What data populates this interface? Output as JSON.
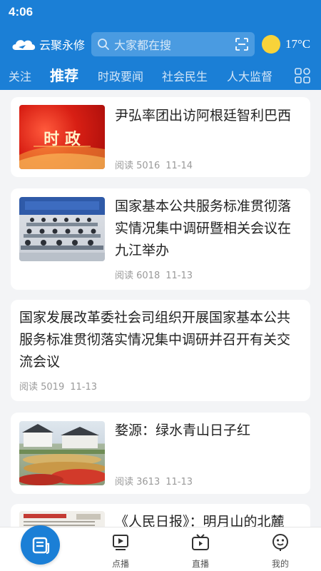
{
  "status_bar": {
    "time": "4:06"
  },
  "header": {
    "app_name": "云聚永修",
    "search": {
      "placeholder": "大家都在搜"
    },
    "weather": {
      "temperature": "17°C"
    }
  },
  "tabs": [
    {
      "label": "关注",
      "active": false
    },
    {
      "label": "推荐",
      "active": true
    },
    {
      "label": "时政要闻",
      "active": false
    },
    {
      "label": "社会民生",
      "active": false
    },
    {
      "label": "人大监督",
      "active": false
    }
  ],
  "articles": [
    {
      "title": "尹弘率团出访阿根廷智利巴西",
      "thumb_label": "时 政",
      "reads": "阅读 5016",
      "date": "11-14"
    },
    {
      "title": "国家基本公共服务标准贯彻落实情况集中调研暨相关会议在九江举办",
      "reads": "阅读 6018",
      "date": "11-13"
    },
    {
      "title": "国家发展改革委社会司组织开展国家基本公共服务标准贯彻落实情况集中调研并召开有关交流会议",
      "reads": "阅读 5019",
      "date": "11-13"
    },
    {
      "title": "婺源：绿水青山日子红",
      "reads": "阅读 3613",
      "date": "11-13"
    },
    {
      "title": "《人民日报》：明月山的北麓"
    }
  ],
  "bottom_nav": [
    {
      "label": "点播"
    },
    {
      "label": "直播"
    },
    {
      "label": "我的"
    }
  ],
  "colors": {
    "brand_blue": "#1b7fd6",
    "sun_yellow": "#f8d33a"
  }
}
